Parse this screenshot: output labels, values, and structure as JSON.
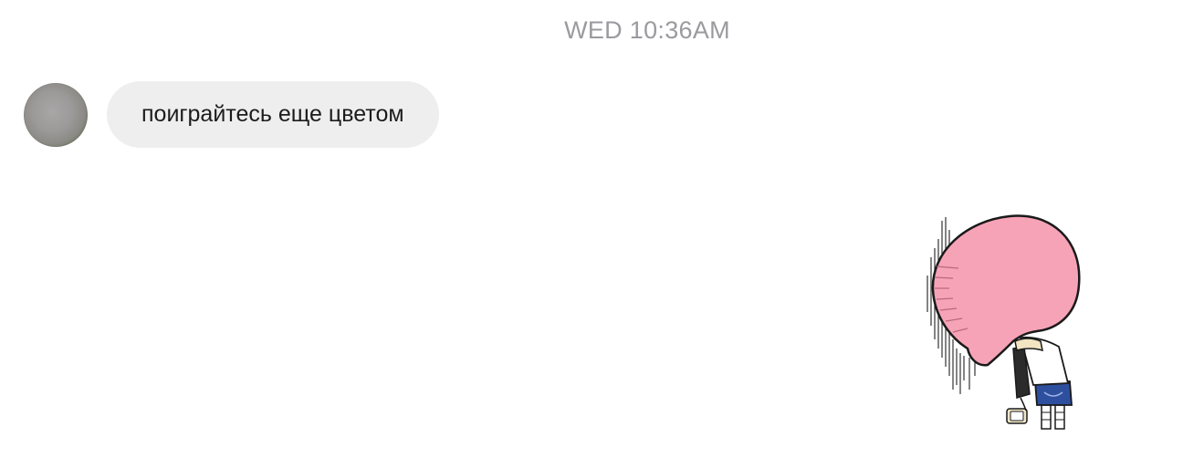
{
  "timestamp": "WED 10:36AM",
  "message": {
    "sender_avatar": "avatar",
    "text": "поиграйтесь еще цветом"
  },
  "sticker": {
    "icon": "pink-hair-character-sticker",
    "colors": {
      "hair": "#f7a3b7",
      "outline": "#1a1a1a",
      "shorts": "#2e4f9e"
    }
  },
  "colors": {
    "timestamp": "#9a9a9f",
    "bubble": "#efeeef",
    "text": "#1c1c1c"
  }
}
